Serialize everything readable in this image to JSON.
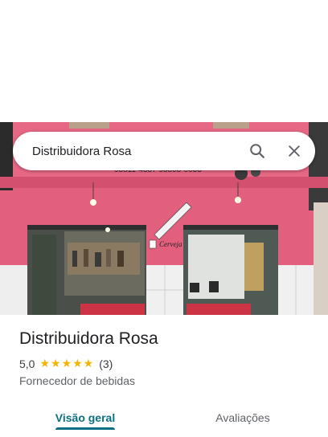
{
  "search": {
    "query": "Distribuidora Rosa"
  },
  "place": {
    "name": "Distribuidora Rosa",
    "rating": "5,0",
    "stars": "★★★★★",
    "review_count": "(3)",
    "category": "Fornecedor de bebidas"
  },
  "photo": {
    "sign_text": "Cerveja",
    "phone_text": "98811-4337    98808-0033"
  },
  "tabs": [
    {
      "label": "Visão geral",
      "active": true
    },
    {
      "label": "Avaliações",
      "active": false
    }
  ],
  "colors": {
    "accent": "#0b7083",
    "star": "#f6b400",
    "wall_pink": "#e8607f",
    "tile_white": "#f1f1f1"
  },
  "icons": [
    "search-icon",
    "close-icon",
    "star-icon"
  ]
}
